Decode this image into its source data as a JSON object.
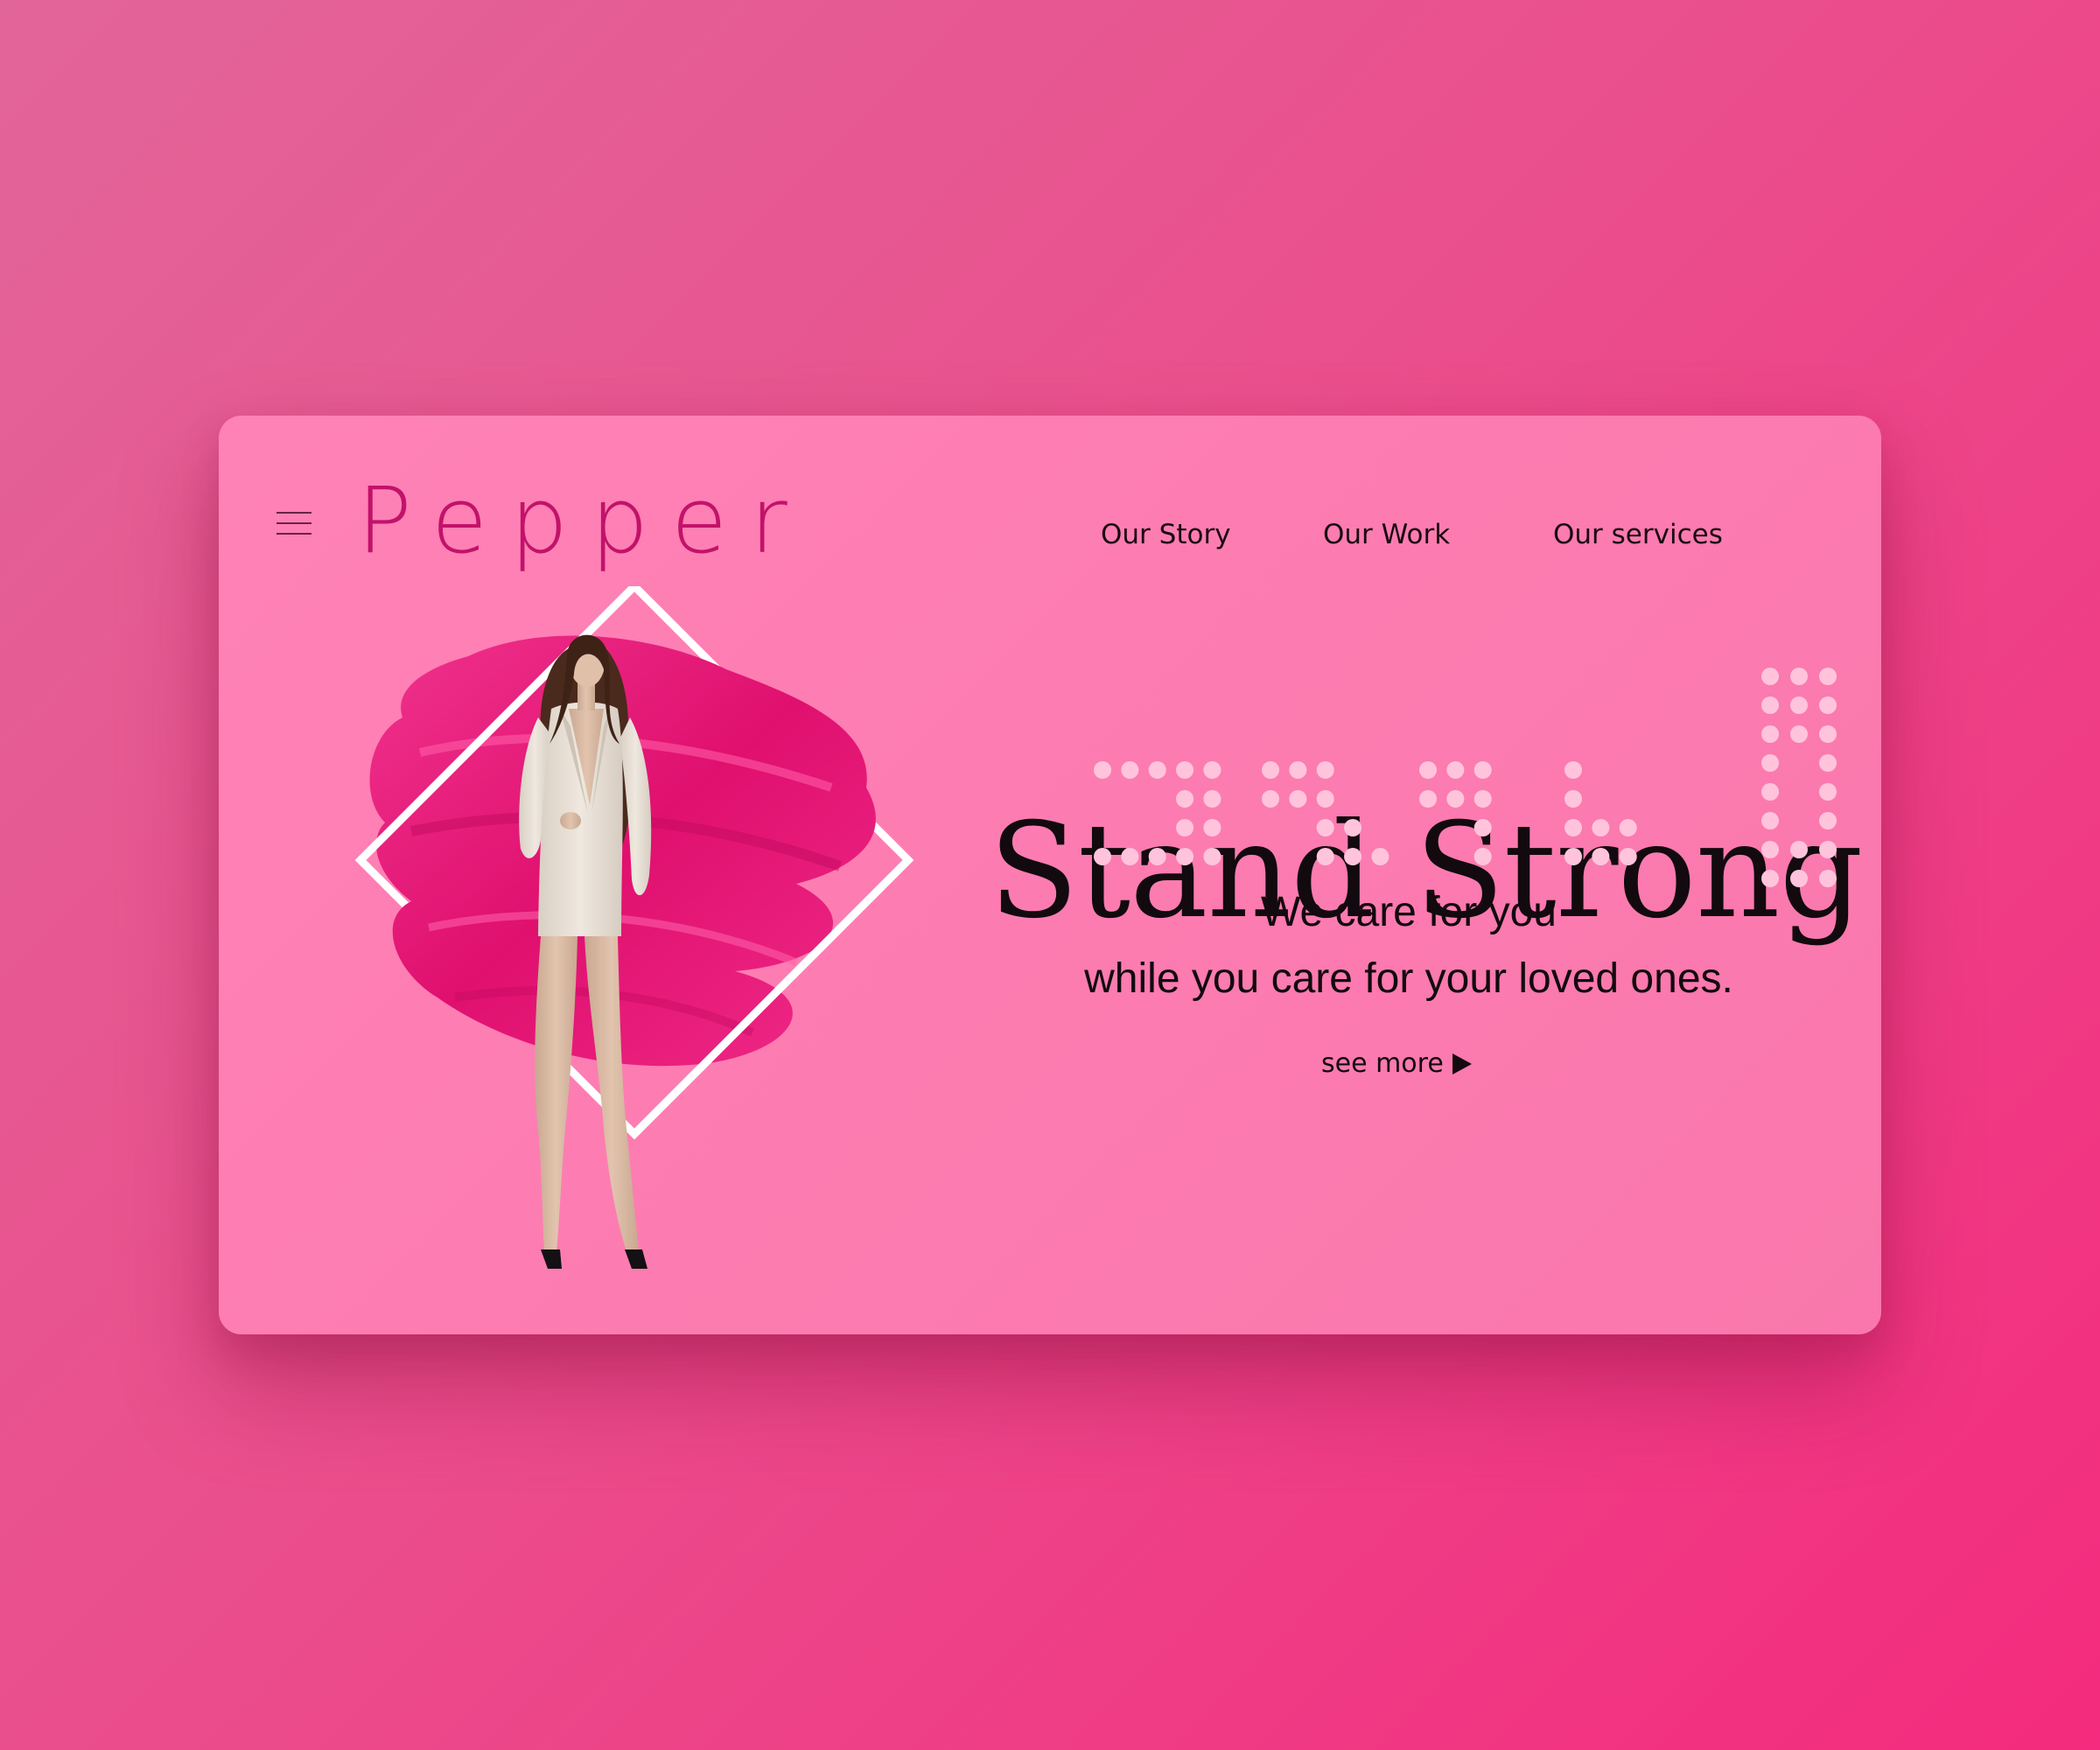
{
  "header": {
    "menu_icon": "hamburger-menu-icon",
    "logo": "Pepper",
    "nav": [
      {
        "label": "Our Story"
      },
      {
        "label": "Our Work"
      },
      {
        "label": "Our services"
      }
    ]
  },
  "hero": {
    "headline": "Stand Strong",
    "subline1": "We care for you",
    "subline2": "while you care for your loved ones.",
    "cta_label": "see more",
    "cta_icon": "play-arrow-icon"
  },
  "colors": {
    "page_background": "#ee4c8b",
    "card_background": "#fd7db3",
    "logo": "#c2126a",
    "brush": "#e8147a",
    "dots": "#ffc4dc"
  }
}
